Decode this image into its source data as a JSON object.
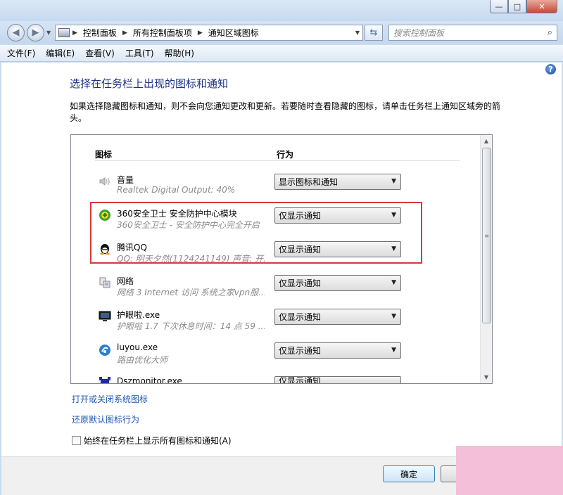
{
  "window": {
    "minimize": "—",
    "maximize": "□",
    "close": "✕"
  },
  "nav": {
    "breadcrumbs": [
      "控制面板",
      "所有控制面板项",
      "通知区域图标"
    ],
    "search_placeholder": "搜索控制面板"
  },
  "menu": [
    "文件(F)",
    "编辑(E)",
    "查看(V)",
    "工具(T)",
    "帮助(H)"
  ],
  "main": {
    "help": "?",
    "title": "选择在任务栏上出现的图标和通知",
    "description": "如果选择隐藏图标和通知，则不会向您通知更改和更新。若要随时查看隐藏的图标，请单击任务栏上通知区域旁的箭头。",
    "columns": {
      "icon": "图标",
      "behavior": "行为"
    },
    "rows": [
      {
        "name": "音量",
        "sub": "Realtek Digital Output: 40%",
        "behavior": "显示图标和通知",
        "icon": "speaker-icon"
      },
      {
        "name": "360安全卫士 安全防护中心模块",
        "sub": "360安全卫士 - 安全防护中心完全开启",
        "behavior": "仅显示通知",
        "icon": "360-shield-icon"
      },
      {
        "name": "腾讯QQ",
        "sub": "QQ: 明天夕然(1124241149)  声音: 开...",
        "behavior": "仅显示通知",
        "icon": "qq-penguin-icon"
      },
      {
        "name": "网络",
        "sub": "网络 3 Internet 访问 系统之家vpn服...",
        "behavior": "仅显示通知",
        "icon": "network-icon"
      },
      {
        "name": "护眼啦.exe",
        "sub": "护眼啦 1.7  下次休息时间：14 点 59 ...",
        "behavior": "仅显示通知",
        "icon": "monitor-icon"
      },
      {
        "name": "luyou.exe",
        "sub": "路由优化大师",
        "behavior": "仅显示通知",
        "icon": "luyou-icon"
      },
      {
        "name": "Dszmonitor.exe",
        "sub": "",
        "behavior": "仅显示通知",
        "icon": "dsz-monitor-icon"
      }
    ],
    "link_system_icons": "打开或关闭系统图标",
    "link_restore": "还原默认图标行为",
    "always_show_label": "始终在任务栏上显示所有图标和通知(A)"
  },
  "buttons": {
    "ok": "确定"
  },
  "colors": {
    "title": "#1e3287",
    "link": "#1e56b0",
    "highlight": "#d9373b"
  }
}
